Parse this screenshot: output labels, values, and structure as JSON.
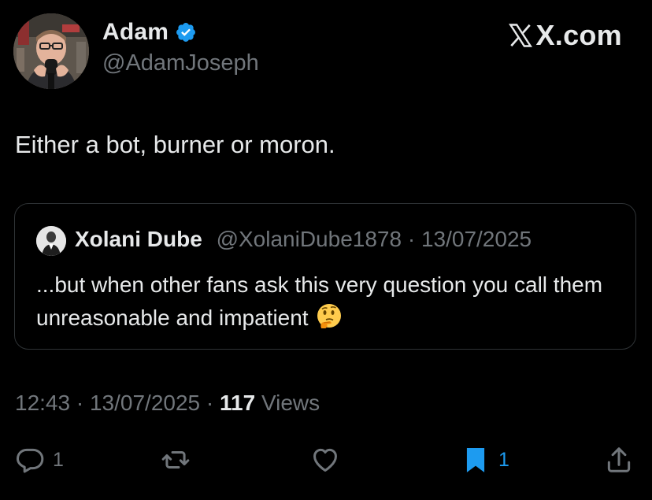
{
  "author": {
    "name": "Adam",
    "handle": "@AdamJoseph",
    "verified": true
  },
  "brand": {
    "text": "X.com",
    "x_glyph": "x-logo-icon"
  },
  "tweet_text": "Either a bot, burner or moron.",
  "quoted": {
    "name": "Xolani Dube",
    "handle": "@XolaniDube1878",
    "separator": "·",
    "date": "13/07/2025",
    "text": "...but when other fans ask this very question you call them unreasonable and impatient",
    "emoji": "thinking-face-emoji"
  },
  "meta": {
    "time": "12:43",
    "separator": "·",
    "date": "13/07/2025",
    "views_count": "117",
    "views_label": "Views"
  },
  "actions": {
    "reply_count": "1",
    "bookmark_count": "1"
  },
  "colors": {
    "background": "#000000",
    "text": "#e7e9ea",
    "secondary": "#71767b",
    "accent": "#1d9bf0",
    "border": "#2f3336"
  }
}
